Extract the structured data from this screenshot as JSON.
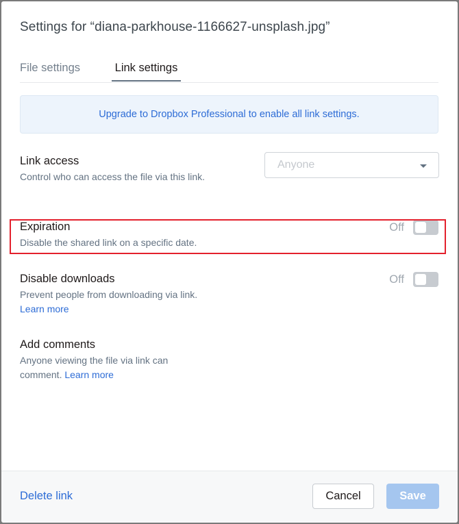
{
  "dialog": {
    "title": "Settings for “diana-parkhouse-1166627-unsplash.jpg”"
  },
  "tabs": [
    {
      "label": "File settings",
      "active": false
    },
    {
      "label": "Link settings",
      "active": true
    }
  ],
  "banner": {
    "text": "Upgrade to Dropbox Professional to enable all link settings."
  },
  "settings": {
    "link_access": {
      "title": "Link access",
      "description": "Control who can access the file via this link.",
      "select_value": "Anyone"
    },
    "expiration": {
      "title": "Expiration",
      "description": "Disable the shared link on a specific date.",
      "toggle_label": "Off",
      "toggle_on": false
    },
    "disable_downloads": {
      "title": "Disable downloads",
      "description": "Prevent people from downloading via link.",
      "link_text": "Learn more",
      "toggle_label": "Off",
      "toggle_on": false
    },
    "add_comments": {
      "title": "Add comments",
      "description": "Anyone viewing the file via link can comment.",
      "link_text": "Learn more"
    }
  },
  "footer": {
    "delete_link_label": "Delete link",
    "cancel_label": "Cancel",
    "save_label": "Save"
  },
  "colors": {
    "accent": "#2d6cd6",
    "banner_bg": "#edf4fc",
    "save_disabled": "#a5c6ef",
    "highlight": "#e3202c"
  }
}
